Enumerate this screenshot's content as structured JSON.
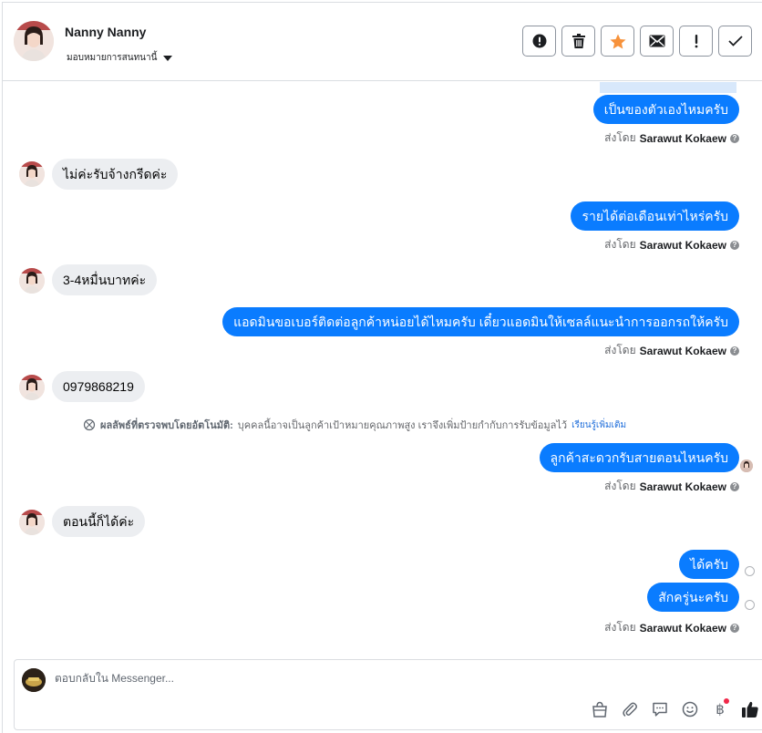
{
  "header": {
    "name": "Nanny Nanny",
    "assign_label": "มอบหมายการสนทนานี้",
    "actions": [
      "spam",
      "delete",
      "star",
      "mark-unread",
      "follow-up",
      "done"
    ]
  },
  "thread": {
    "messages": [
      {
        "dir": "out",
        "text": "เป็นของตัวเองไหมครับ"
      },
      {
        "dir": "in",
        "text": "ไม่ค่ะรับจ้างกรีดค่ะ"
      },
      {
        "dir": "out",
        "text": "รายได้ต่อเดือนเท่าไหร่ครับ"
      },
      {
        "dir": "in",
        "text": "3-4หมื่นบาทค่ะ"
      },
      {
        "dir": "out",
        "text": "แอดมินขอเบอร์ติดต่อลูกค้าหน่อยได้ไหมครับ เดี๋ยวแอดมินให้เซลล์แนะนำการออกรถให้ครับ"
      },
      {
        "dir": "in",
        "text": "0979868219"
      },
      {
        "dir": "out",
        "text": "ลูกค้าสะดวกรับสายตอนไหนครับ"
      },
      {
        "dir": "in",
        "text": "ตอนนี้ก็ได้ค่ะ"
      },
      {
        "dir": "out",
        "text": "ได้ครับ"
      },
      {
        "dir": "out",
        "text": "สักครู่นะครับ"
      }
    ],
    "sent_by_label": "ส่งโดย",
    "sender_name": "Sarawut Kokaew",
    "notice": {
      "title": "ผลลัพธ์ที่ตรวจพบโดยอัตโนมัติ:",
      "body": "บุคคลนี้อาจเป็นลูกค้าเป้าหมายคุณภาพสูง เราจึงเพิ่มป้ายกำกับการรับข้อมูลไว้",
      "link": "เรียนรู้เพิ่มเติม"
    }
  },
  "composer": {
    "placeholder": "ตอบกลับใน Messenger...",
    "currency_symbol": "฿",
    "tools": [
      "shop-icon",
      "attachment-icon",
      "saved-reply-icon",
      "emoji-icon",
      "payment-icon",
      "like-icon"
    ]
  },
  "colors": {
    "accent": "#0a7cff",
    "incoming_bg": "#eceef1",
    "star": "#f7923b",
    "notification_dot": "#f02849"
  }
}
